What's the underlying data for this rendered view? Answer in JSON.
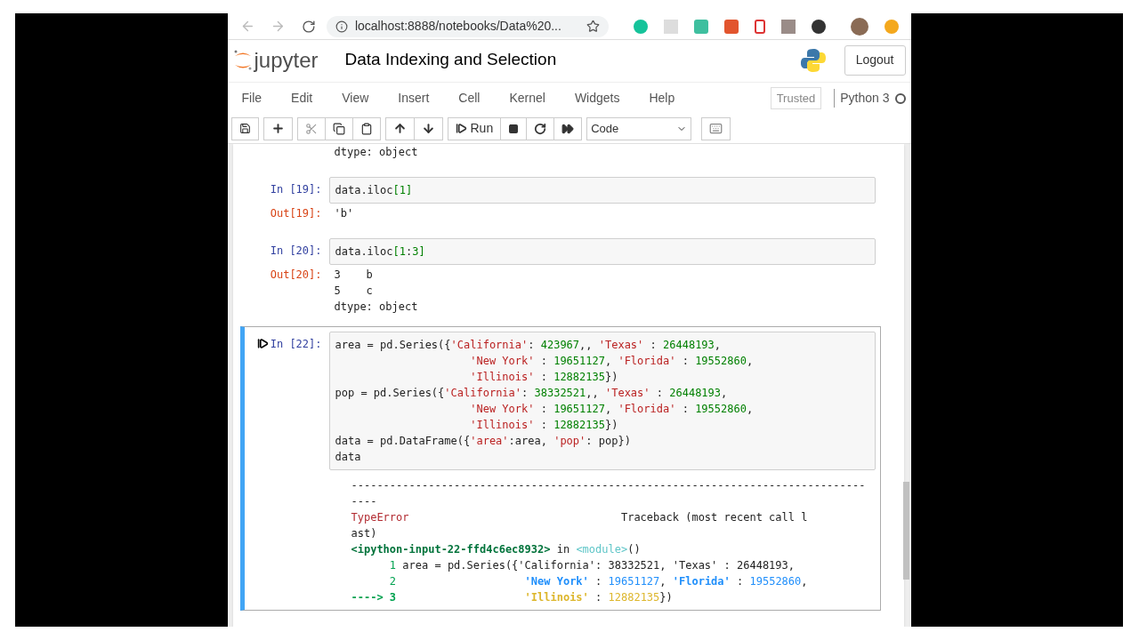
{
  "browser": {
    "url": "localhost:8888/notebooks/Data%20..."
  },
  "header": {
    "logo_text": "jupyter",
    "title": "Data Indexing and Selection",
    "logout": "Logout"
  },
  "menu": [
    "File",
    "Edit",
    "View",
    "Insert",
    "Cell",
    "Kernel",
    "Widgets",
    "Help"
  ],
  "trusted": "Trusted",
  "kernel": "Python 3",
  "toolbar": {
    "run": "Run",
    "cell_type": "Code"
  },
  "cells": [
    {
      "kind": "output_tail",
      "selected": false,
      "output": [
        "dtype: object"
      ]
    },
    {
      "kind": "code",
      "selected": false,
      "in_prompt": "In [19]:",
      "code": [
        "data.iloc[1]"
      ],
      "out_prompt": "Out[19]:",
      "output": [
        "'b'"
      ]
    },
    {
      "kind": "code",
      "selected": false,
      "in_prompt": "In [20]:",
      "code": [
        "data.iloc[1:3]"
      ],
      "out_prompt": "Out[20]:",
      "output": [
        "3    b",
        "5    c",
        "dtype: object"
      ]
    },
    {
      "kind": "error",
      "selected": true,
      "in_prompt": "In [22]:",
      "code": [
        "area = pd.Series({'California': 423967,, 'Texas' : 26448193,",
        "                     'New York' : 19651127, 'Florida' : 19552860,",
        "                     'Illinois' : 12882135})",
        "pop = pd.Series({'California': 38332521,, 'Texas' : 26448193,",
        "                     'New York' : 19651127, 'Florida' : 19552860,",
        "                     'Illinois' : 12882135})",
        "data = pd.DataFrame({'area':area, 'pop': pop})",
        "data"
      ],
      "traceback": [
        [
          {
            "text": "--------------------------------------------------------------------------------",
            "kind": "plain"
          }
        ],
        [
          {
            "text": "----",
            "kind": "plain"
          }
        ],
        [
          {
            "text": "TypeError",
            "kind": "ename"
          },
          {
            "text": "                                 Traceback (most recent call l",
            "kind": "plain"
          }
        ],
        [
          {
            "text": "ast)",
            "kind": "plain"
          }
        ],
        [
          {
            "text": "<ipython-input-22-ffd4c6ec8932>",
            "kind": "frame"
          },
          {
            "text": " in ",
            "kind": "plain"
          },
          {
            "text": "<module>",
            "kind": "module"
          },
          {
            "text": "()",
            "kind": "plain"
          }
        ],
        [
          {
            "text": "      1",
            "kind": "lineno"
          },
          {
            "text": " area = pd.Series({'California': 38332521, 'Texas' : 26448193,",
            "kind": "plain"
          }
        ],
        [
          {
            "text": "      2",
            "kind": "lineno"
          },
          {
            "text": "                    'New York'",
            "kind": "str"
          },
          {
            "text": " : ",
            "kind": "plain"
          },
          {
            "text": "19651127",
            "kind": "num"
          },
          {
            "text": ", ",
            "kind": "plain"
          },
          {
            "text": "'Florida'",
            "kind": "str"
          },
          {
            "text": " : ",
            "kind": "plain"
          },
          {
            "text": "19552860",
            "kind": "num"
          },
          {
            "text": ",",
            "kind": "plain"
          }
        ],
        [
          {
            "text": "----> 3",
            "kind": "arrow"
          },
          {
            "text": "                    'Illinois'",
            "kind": "hlstr"
          },
          {
            "text": " : ",
            "kind": "plain"
          },
          {
            "text": "12882135",
            "kind": "hlnum"
          },
          {
            "text": "})",
            "kind": "plain"
          }
        ]
      ]
    }
  ]
}
